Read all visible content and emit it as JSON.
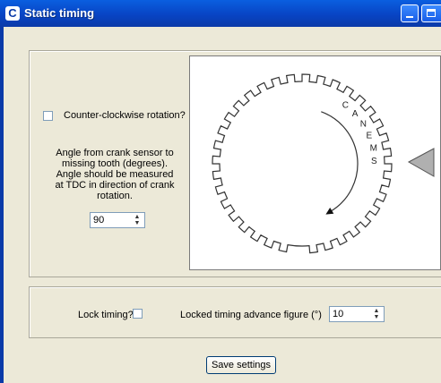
{
  "window": {
    "title": "Static timing",
    "app_icon_letter": "C"
  },
  "settings": {
    "ccw_label": "Counter-clockwise rotation?",
    "ccw_checked": false,
    "angle_description": "Angle from crank sensor to missing tooth (degrees).  Angle should be measured at TDC in direction of crank rotation.",
    "angle_value": "90"
  },
  "wheel": {
    "brand_text": "CANEMS",
    "tooth_count": 36,
    "missing_teeth": 1
  },
  "lock": {
    "lock_label": "Lock timing?",
    "lock_checked": false,
    "advance_label": "Locked timing advance figure (°)",
    "advance_value": "10"
  },
  "footer": {
    "save_label": "Save settings"
  }
}
